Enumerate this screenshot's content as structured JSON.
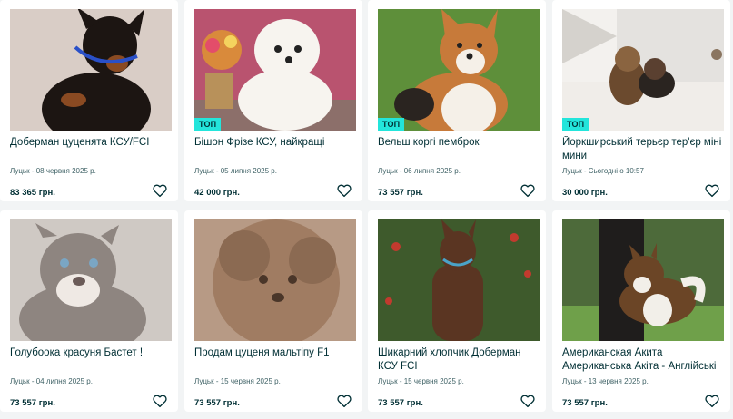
{
  "listings": [
    {
      "title": "Доберман цуценята КСУ/FCI",
      "meta": "Луцьк - 08 червня 2025 р.",
      "price": "83 365 грн.",
      "top": false,
      "badge": "",
      "photo": "doberman-puppy-photo",
      "colors": {
        "bg": "#d9cdc6",
        "main": "#1c1512",
        "accent": "#8a4a22"
      }
    },
    {
      "title": "Бішон Фрізе КСУ, найкращі",
      "meta": "Луцьк - 05 липня 2025 р.",
      "price": "42 000 грн.",
      "top": true,
      "badge": "ТОП",
      "photo": "bichon-frise-photo",
      "colors": {
        "bg": "#b9536f",
        "main": "#f7f4ef",
        "accent": "#d98a3b"
      }
    },
    {
      "title": "Вельш коргі пемброк",
      "meta": "Луцьк - 06 липня 2025 р.",
      "price": "73 557 грн.",
      "top": true,
      "badge": "ТОП",
      "photo": "corgi-photo",
      "colors": {
        "bg": "#5e8f3a",
        "main": "#c77a3a",
        "accent": "#f5f0e8"
      }
    },
    {
      "title": "Йоркширський терьєр тер'єр міні мини",
      "meta": "Луцьк - Сьогодні о 10:57",
      "price": "30 000 грн.",
      "top": true,
      "badge": "ТОП",
      "photo": "yorkshire-terrier-photo",
      "colors": {
        "bg": "#e4e2df",
        "main": "#6b4a2e",
        "accent": "#2a2420"
      }
    },
    {
      "title": "Голубоока красуня Бастет !",
      "meta": "Луцьк - 04 липня 2025 р.",
      "price": "73 557 грн.",
      "top": false,
      "badge": "",
      "photo": "bully-puppy-photo",
      "colors": {
        "bg": "#cfc9c4",
        "main": "#8e8580",
        "accent": "#efe9e4"
      }
    },
    {
      "title": "Продам цуценя мальтіпу F1",
      "meta": "Луцьк - 15 червня 2025 р.",
      "price": "73 557 грн.",
      "top": false,
      "badge": "",
      "photo": "maltipoo-photo",
      "colors": {
        "bg": "#b79a85",
        "main": "#a07c62",
        "accent": "#4a3629"
      }
    },
    {
      "title": "Шикарний хлопчик Доберман КСУ FCI",
      "meta": "Луцьк - 15 червня 2025 р.",
      "price": "73 557 грн.",
      "top": false,
      "badge": "",
      "photo": "doberman-adult-photo",
      "colors": {
        "bg": "#3e5a2c",
        "main": "#5a3522",
        "accent": "#c23a2e"
      }
    },
    {
      "title": "Американская Акита Американська Акіта - Англійські крові ! КСУ",
      "meta": "Луцьк - 13 червня 2025 р.",
      "price": "73 557 грн.",
      "top": false,
      "badge": "",
      "photo": "akita-photo",
      "colors": {
        "bg": "#4d6a3a",
        "main": "#6b4526",
        "accent": "#f2efe9"
      }
    }
  ]
}
